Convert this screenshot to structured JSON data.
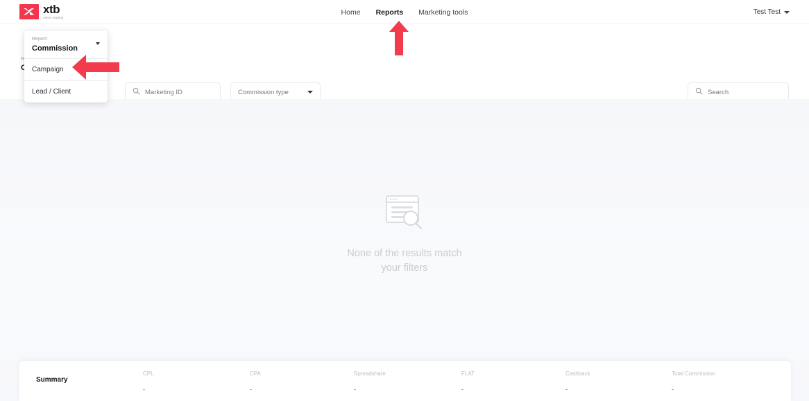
{
  "brand": {
    "name": "xtb",
    "tagline": "online trading",
    "accent": "#f4364c"
  },
  "nav": {
    "items": [
      {
        "label": "Home",
        "active": false
      },
      {
        "label": "Reports",
        "active": true
      },
      {
        "label": "Marketing tools",
        "active": false
      }
    ]
  },
  "user": {
    "name": "Test Test"
  },
  "filters": {
    "report_selector": {
      "label": "Report:",
      "value": "Commission",
      "options": [
        "Campaign",
        "Lead / Client"
      ]
    },
    "marketing_id": {
      "placeholder": "Marketing ID",
      "value": "",
      "icon": "search-icon"
    },
    "commission_type": {
      "placeholder": "Commission type",
      "value": "",
      "icon": "chevron-down-icon"
    },
    "search": {
      "placeholder": "Search",
      "value": "",
      "icon": "search-icon"
    }
  },
  "empty_state": {
    "icon": "document-search-icon",
    "line1": "None of the results match",
    "line2": "your filters"
  },
  "summary": {
    "label": "Summary",
    "columns": [
      {
        "header": "CPL",
        "value": "-"
      },
      {
        "header": "CPA",
        "value": "-"
      },
      {
        "header": "Spreadshare",
        "value": "-"
      },
      {
        "header": "FLAT",
        "value": "-"
      },
      {
        "header": "Cashback",
        "value": "-"
      },
      {
        "header": "Total Commission",
        "value": "-"
      }
    ]
  },
  "annotations": {
    "arrow_up_target": "Reports",
    "arrow_left_target": "Campaign",
    "color": "#f23b4c"
  }
}
